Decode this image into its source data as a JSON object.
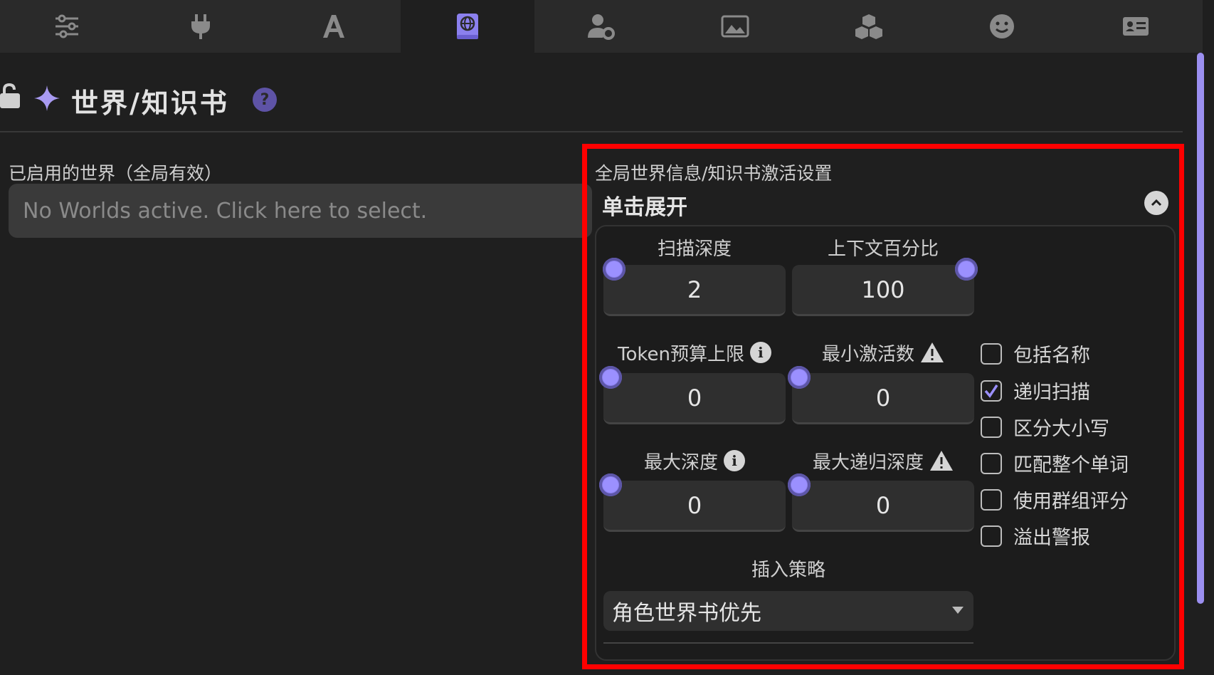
{
  "tabs": [
    {
      "icon": "sliders-icon"
    },
    {
      "icon": "plug-icon"
    },
    {
      "icon": "font-icon"
    },
    {
      "icon": "globe-book-icon",
      "active": true
    },
    {
      "icon": "user-gear-icon"
    },
    {
      "icon": "image-icon"
    },
    {
      "icon": "cubes-icon"
    },
    {
      "icon": "smile-icon"
    },
    {
      "icon": "id-card-icon"
    }
  ],
  "header": {
    "title": "世界/知识书",
    "help": "?"
  },
  "active_worlds": {
    "label": "已启用的世界（全局有效）",
    "placeholder": "No Worlds active. Click here to select."
  },
  "settings": {
    "title": "全局世界信息/知识书激活设置",
    "expand_label": "单击展开",
    "scan_depth": {
      "label": "扫描深度",
      "value": "2"
    },
    "context_percent": {
      "label": "上下文百分比",
      "value": "100"
    },
    "token_budget": {
      "label": "Token预算上限",
      "value": "0"
    },
    "min_activations": {
      "label": "最小激活数",
      "value": "0"
    },
    "max_depth": {
      "label": "最大深度",
      "value": "0"
    },
    "max_recursion": {
      "label": "最大递归深度",
      "value": "0"
    },
    "checkboxes": [
      {
        "label": "包括名称",
        "checked": false
      },
      {
        "label": "递归扫描",
        "checked": true
      },
      {
        "label": "区分大小写",
        "checked": false
      },
      {
        "label": "匹配整个单词",
        "checked": false
      },
      {
        "label": "使用群组评分",
        "checked": false
      },
      {
        "label": "溢出警报",
        "checked": false
      }
    ],
    "strategy": {
      "label": "插入策略",
      "value": "角色世界书优先"
    }
  },
  "colors": {
    "accent": "#8b80ee",
    "highlight_box": "#ff0000",
    "background": "#1f1f1f"
  }
}
